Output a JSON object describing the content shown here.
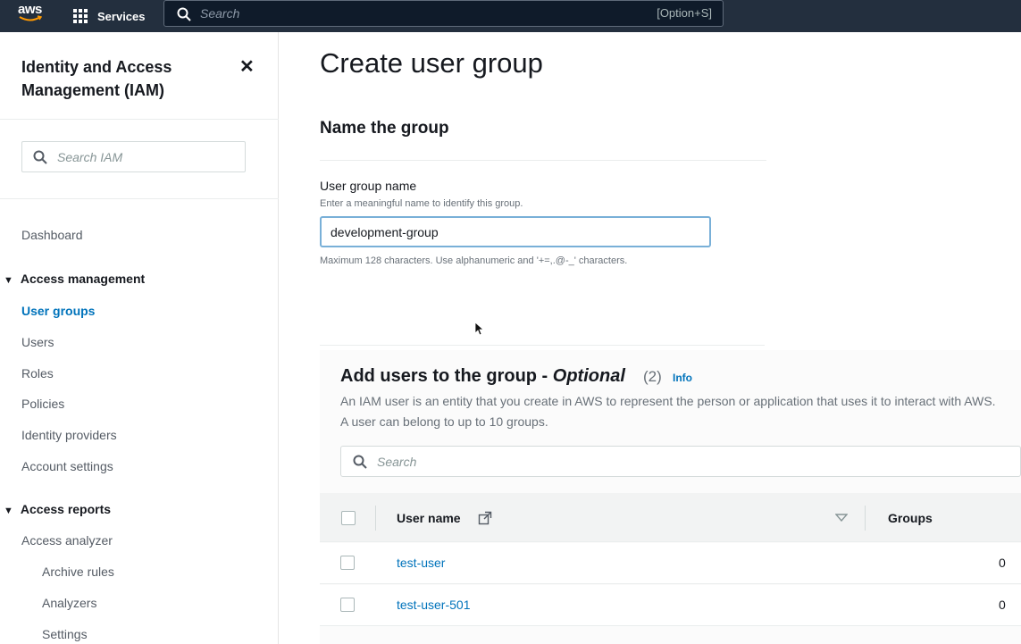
{
  "topnav": {
    "logo": "aws",
    "services": "Services",
    "search_placeholder": "Search",
    "search_shortcut": "[Option+S]"
  },
  "sidebar": {
    "title": "Identity and Access Management (IAM)",
    "search_placeholder": "Search IAM",
    "dashboard": "Dashboard",
    "access_management": "Access management",
    "access_items": [
      "User groups",
      "Users",
      "Roles",
      "Policies",
      "Identity providers",
      "Account settings"
    ],
    "access_reports": "Access reports",
    "report_items": [
      "Access analyzer",
      "Archive rules",
      "Analyzers",
      "Settings"
    ]
  },
  "main": {
    "title": "Create user group",
    "section_title": "Name the group",
    "group_name_label": "User group name",
    "group_name_desc": "Enter a meaningful name to identify this group.",
    "group_name_value": "development-group",
    "group_name_constraint": "Maximum 128 characters. Use alphanumeric and '+=,.@-_' characters.",
    "users_section": {
      "title_prefix": "Add users to the group - ",
      "title_optional": "Optional",
      "count": "(2)",
      "info": "Info",
      "description": "An IAM user is an entity that you create in AWS to represent the person or application that uses it to interact with AWS. A user can belong to up to 10 groups.",
      "search_placeholder": "Search",
      "col_username": "User name",
      "col_groups": "Groups",
      "rows": [
        {
          "name": "test-user",
          "groups": "0"
        },
        {
          "name": "test-user-501",
          "groups": "0"
        }
      ]
    }
  },
  "colors": {
    "nav_bg": "#232f3e",
    "link": "#0073bb",
    "text": "#16191f",
    "muted": "#687078"
  }
}
